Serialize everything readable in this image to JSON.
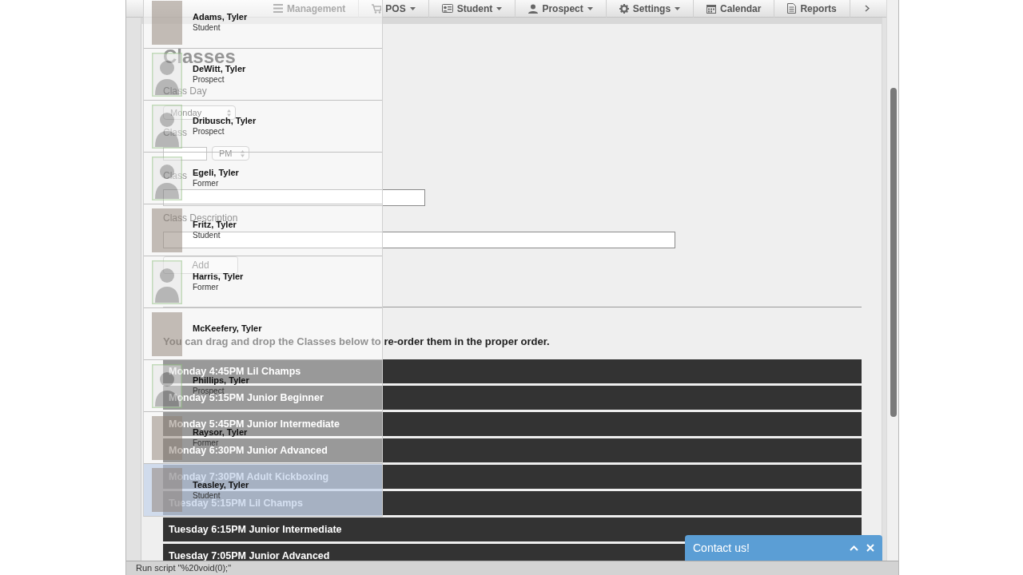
{
  "nav": {
    "items": [
      {
        "label": "Management",
        "caret": false
      },
      {
        "label": "POS",
        "caret": true
      },
      {
        "label": "Student",
        "caret": true
      },
      {
        "label": "Prospect",
        "caret": true
      },
      {
        "label": "Settings",
        "caret": true
      },
      {
        "label": "Calendar",
        "caret": false
      },
      {
        "label": "Reports",
        "caret": false
      }
    ]
  },
  "page": {
    "title": "Classes",
    "form": {
      "day_label": "Class Day",
      "day_value": "Monday",
      "time_label": "Class",
      "meridiem_value": "PM",
      "name_label": "Class",
      "description_label": "Class Description",
      "add_button": "Add"
    },
    "instruction": "You can drag and drop the Classes below to re-order them in the proper order.",
    "classes": [
      "Monday 4:45PM Lil Champs",
      "Monday 5:15PM Junior Beginner",
      "Monday 5:45PM Junior Intermediate",
      "Monday 6:30PM Junior Advanced",
      "Monday 7:30PM Adult Kickboxing",
      "Tuesday 5:15PM Lil Champs",
      "Tuesday 6:15PM Junior Intermediate",
      "Tuesday 7:05PM Junior Advanced"
    ]
  },
  "search_results": [
    {
      "name": "Adams, Tyler",
      "status": "Student",
      "kind": "photo",
      "selected": false
    },
    {
      "name": "DeWitt, Tyler",
      "status": "Prospect",
      "kind": "silhouette",
      "selected": false
    },
    {
      "name": "Dribusch, Tyler",
      "status": "Prospect",
      "kind": "silhouette",
      "selected": false
    },
    {
      "name": "Egeli, Tyler",
      "status": "Former",
      "kind": "silhouette",
      "selected": false
    },
    {
      "name": "Fritz, Tyler",
      "status": "Student",
      "kind": "photo",
      "selected": false
    },
    {
      "name": "Harris, Tyler",
      "status": "Former",
      "kind": "silhouette",
      "selected": false
    },
    {
      "name": "McKeefery, Tyler",
      "kind": "photo",
      "selected": false
    },
    {
      "name": "Phillips, Tyler",
      "status": "Prospect",
      "kind": "silhouette",
      "selected": false
    },
    {
      "name": "Raysor, Tyler",
      "status": "Former",
      "kind": "photo",
      "selected": false
    },
    {
      "name": "Teasley, Tyler",
      "status": "Student",
      "kind": "photo",
      "selected": true
    }
  ],
  "contact_widget": {
    "label": "Contact us!"
  },
  "status_bar": {
    "text": "Run script \"%20void(0);\""
  }
}
